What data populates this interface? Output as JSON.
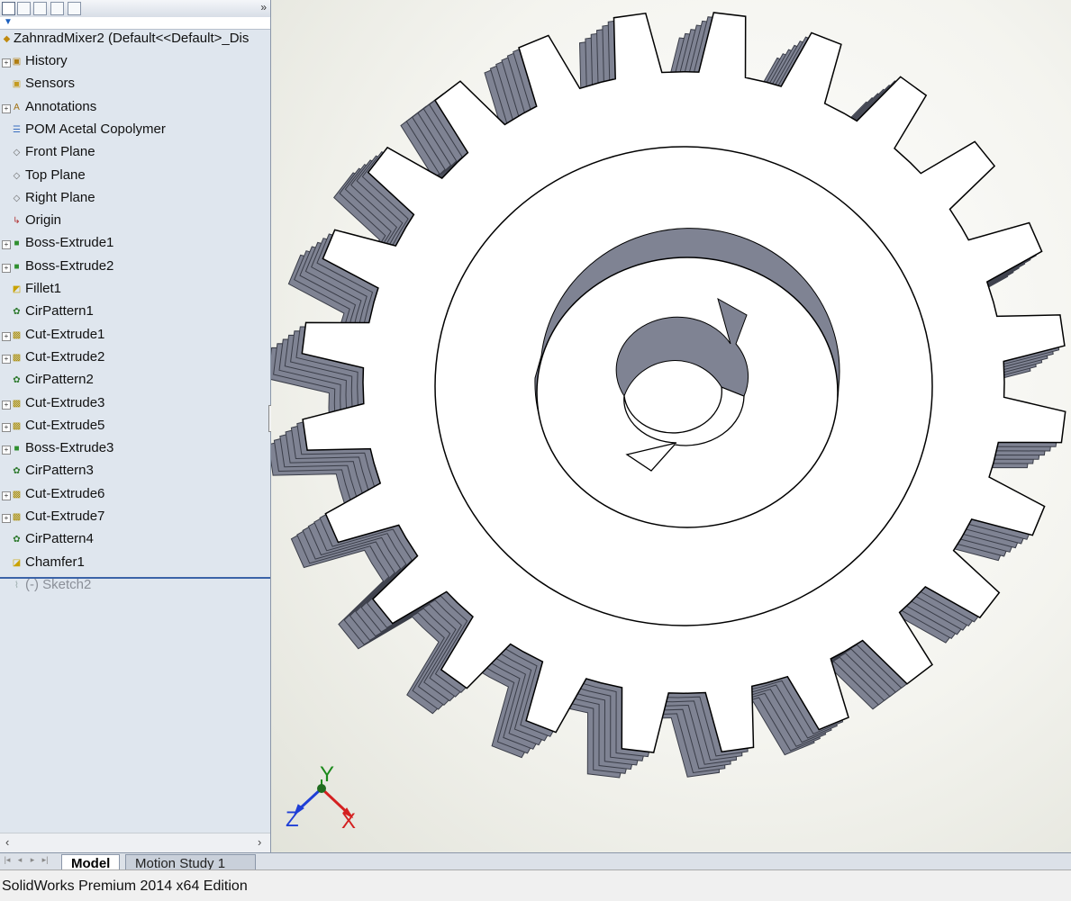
{
  "feature_manager": {
    "tabs": [
      "feature-manager-tab",
      "property-manager-tab",
      "configuration-manager-tab",
      "dimxpert-tab",
      "display-manager-tab"
    ],
    "expand_glyph": "»",
    "root": "ZahnradMixer2  (Default<<Default>_Dis",
    "items": [
      {
        "label": "History",
        "icon": "history-icon",
        "expand": true
      },
      {
        "label": "Sensors",
        "icon": "sensors-icon",
        "expand": false
      },
      {
        "label": "Annotations",
        "icon": "annotations-icon",
        "expand": true
      },
      {
        "label": "POM Acetal Copolymer",
        "icon": "material-icon",
        "expand": false
      },
      {
        "label": "Front Plane",
        "icon": "plane-icon",
        "expand": false
      },
      {
        "label": "Top Plane",
        "icon": "plane-icon",
        "expand": false
      },
      {
        "label": "Right Plane",
        "icon": "plane-icon",
        "expand": false
      },
      {
        "label": "Origin",
        "icon": "origin-icon",
        "expand": false
      },
      {
        "label": "Boss-Extrude1",
        "icon": "boss-extrude-icon",
        "expand": true
      },
      {
        "label": "Boss-Extrude2",
        "icon": "boss-extrude-icon",
        "expand": true
      },
      {
        "label": "Fillet1",
        "icon": "fillet-icon",
        "expand": false
      },
      {
        "label": "CirPattern1",
        "icon": "circular-pattern-icon",
        "expand": false
      },
      {
        "label": "Cut-Extrude1",
        "icon": "cut-extrude-icon",
        "expand": true
      },
      {
        "label": "Cut-Extrude2",
        "icon": "cut-extrude-icon",
        "expand": true
      },
      {
        "label": "CirPattern2",
        "icon": "circular-pattern-icon",
        "expand": false
      },
      {
        "label": "Cut-Extrude3",
        "icon": "cut-extrude-icon",
        "expand": true
      },
      {
        "label": "Cut-Extrude5",
        "icon": "cut-extrude-icon",
        "expand": true
      },
      {
        "label": "Boss-Extrude3",
        "icon": "boss-extrude-icon",
        "expand": true
      },
      {
        "label": "CirPattern3",
        "icon": "circular-pattern-icon",
        "expand": false
      },
      {
        "label": "Cut-Extrude6",
        "icon": "cut-extrude-icon",
        "expand": true
      },
      {
        "label": "Cut-Extrude7",
        "icon": "cut-extrude-icon",
        "expand": true
      },
      {
        "label": "CirPattern4",
        "icon": "circular-pattern-icon",
        "expand": false
      },
      {
        "label": "Chamfer1",
        "icon": "chamfer-icon",
        "expand": false
      }
    ],
    "rolled_back": {
      "label": "(-) Sketch2",
      "icon": "sketch-icon"
    }
  },
  "viewport": {
    "model": "gear",
    "gear_teeth": 24,
    "triad": {
      "x": "X",
      "y": "Y",
      "z": "Z"
    },
    "colors": {
      "face": "#ffffff",
      "side": "#7f8393",
      "edge": "#000000",
      "x": "#d42020",
      "y": "#1a8a1a",
      "z": "#1f3fd6"
    }
  },
  "bottom_tabs": {
    "model": "Model",
    "motion": "Motion Study 1"
  },
  "status": {
    "text": "SolidWorks Premium 2014 x64 Edition"
  }
}
